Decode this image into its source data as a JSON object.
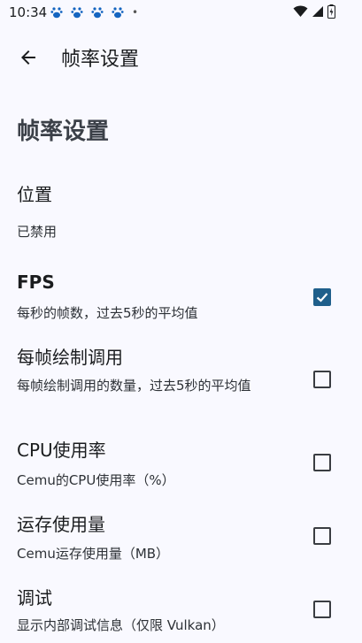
{
  "status_bar": {
    "time": "10:34",
    "notification_icons": [
      "baidu-icon",
      "baidu-icon",
      "baidu-icon",
      "baidu-icon"
    ],
    "more_dot": "•"
  },
  "app_bar": {
    "back_icon": "arrow-back-icon",
    "title": "帧率设置"
  },
  "section_title": "帧率设置",
  "preferences": [
    {
      "title": "位置",
      "summary": "已禁用",
      "has_checkbox": false
    },
    {
      "title": "FPS",
      "summary": "每秒的帧数，过去5秒的平均值",
      "checked": true
    },
    {
      "title": "每帧绘制调用",
      "summary": "每帧绘制调用的数量，过去5秒的平均值",
      "checked": false
    },
    {
      "title": "CPU使用率",
      "summary": "Cemu的CPU使用率（%）",
      "checked": false
    },
    {
      "title": "运存使用量",
      "summary": "Cemu运存使用量（MB）",
      "checked": false
    },
    {
      "title": "调试",
      "summary": "显示内部调试信息（仅限 Vulkan）",
      "checked": false
    }
  ],
  "colors": {
    "background": "#f9f9ff",
    "accent": "#1f5f8b",
    "text": "#1a1c1e"
  }
}
